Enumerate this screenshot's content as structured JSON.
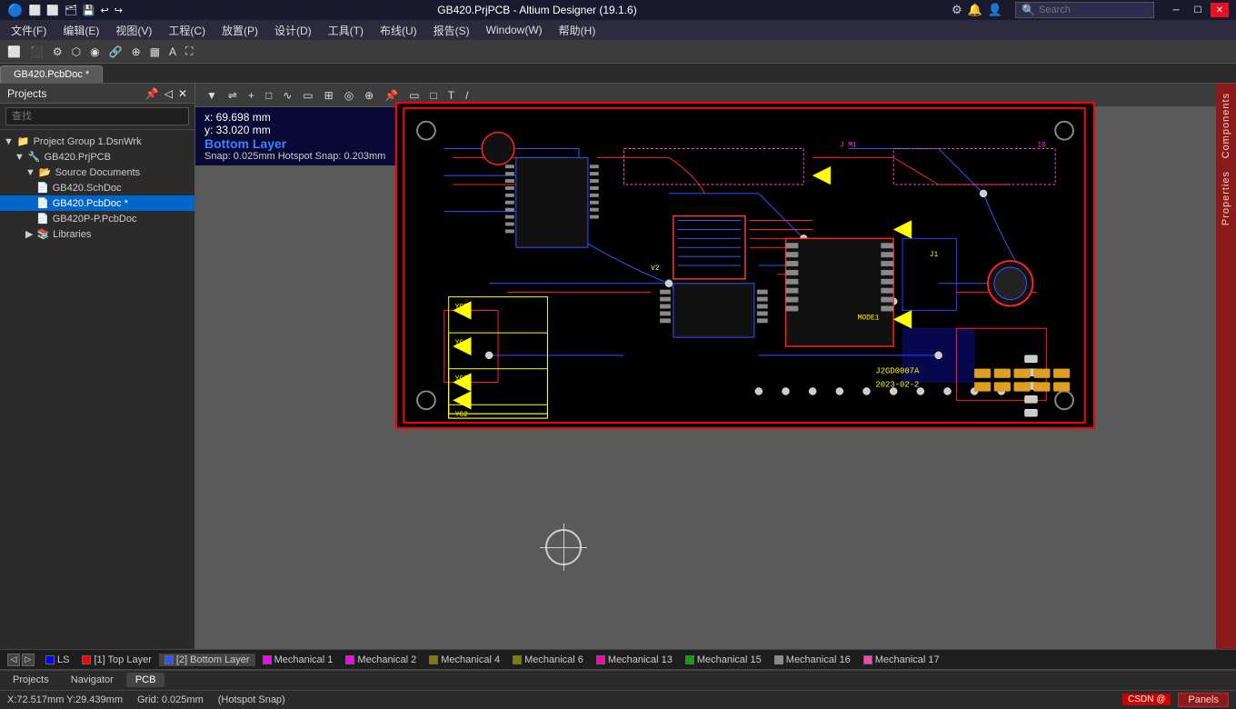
{
  "titleBar": {
    "title": "GB420.PrjPCB - Altium Designer (19.1.6)",
    "searchPlaceholder": "Search",
    "minBtn": "─",
    "maxBtn": "☐",
    "closeBtn": "✕"
  },
  "menuBar": {
    "items": [
      {
        "label": "文件(F)"
      },
      {
        "label": "编辑(E)"
      },
      {
        "label": "视图(V)"
      },
      {
        "label": "工程(C)"
      },
      {
        "label": "放置(P)"
      },
      {
        "label": "设计(D)"
      },
      {
        "label": "工具(T)"
      },
      {
        "label": "布线(U)"
      },
      {
        "label": "报告(S)"
      },
      {
        "label": "Window(W)"
      },
      {
        "label": "帮助(H)"
      }
    ]
  },
  "tabs": [
    {
      "label": "GB420.PcbDoc *",
      "active": true
    }
  ],
  "coordBar": {
    "x": "x: 69.698 mm",
    "y": "y: 33.020 mm",
    "layer": "Bottom Layer",
    "snap": "Snap: 0.025mm Hotspot Snap: 0.203mm"
  },
  "leftPanel": {
    "title": "Projects",
    "searchPlaceholder": "查找",
    "tree": [
      {
        "level": 0,
        "label": "Project Group 1.DsnWrk",
        "icon": "▼",
        "type": "group"
      },
      {
        "level": 1,
        "label": "GB420.PrjPCB",
        "icon": "▼",
        "type": "project"
      },
      {
        "level": 2,
        "label": "Source Documents",
        "icon": "▼",
        "type": "folder"
      },
      {
        "level": 3,
        "label": "GB420.SchDoc",
        "icon": "📄",
        "type": "file"
      },
      {
        "level": 3,
        "label": "GB420.PcbDoc *",
        "icon": "📄",
        "type": "file",
        "selected": true
      },
      {
        "level": 3,
        "label": "GB420P-P.PcbDoc",
        "icon": "📄",
        "type": "file"
      },
      {
        "level": 2,
        "label": "Libraries",
        "icon": "▶",
        "type": "folder"
      }
    ]
  },
  "rightSideTabs": [
    {
      "label": "Components"
    },
    {
      "label": "Properties"
    }
  ],
  "layerBar": {
    "layers": [
      {
        "label": "LS",
        "color": "#0000ff"
      },
      {
        "label": "[1] Top Layer",
        "color": "#ff0000",
        "active": false
      },
      {
        "label": "[2] Bottom Layer",
        "color": "#4444ff",
        "active": true
      },
      {
        "label": "Mechanical 1",
        "color": "#ff00ff"
      },
      {
        "label": "Mechanical 2",
        "color": "#ff00ff"
      },
      {
        "label": "Mechanical 4",
        "color": "#808000"
      },
      {
        "label": "Mechanical 6",
        "color": "#808000"
      },
      {
        "label": "Mechanical 13",
        "color": "#ff00aa"
      },
      {
        "label": "Mechanical 15",
        "color": "#00aa00"
      },
      {
        "label": "Mechanical 16",
        "color": "#888888"
      },
      {
        "label": "Mechanical 17",
        "color": "#ff44aa"
      }
    ]
  },
  "bottomTabs": [
    {
      "label": "Projects",
      "active": false
    },
    {
      "label": "Navigator",
      "active": false
    },
    {
      "label": "PCB",
      "active": true
    }
  ],
  "statusBar": {
    "coords": "X:72.517mm Y:29.439mm",
    "grid": "Grid: 0.025mm",
    "snap": "(Hotspot Snap)",
    "panels": "Panels",
    "csdn": "CSDN @"
  },
  "pcbToolbar": {
    "icons": [
      "▼",
      "⊕",
      "+",
      "□",
      "∿",
      "▭",
      "⊞",
      "◈",
      "⊕",
      "📌",
      "▭",
      "□",
      "T",
      "/"
    ]
  },
  "colors": {
    "titleBarBg": "#1a1a2e",
    "menuBarBg": "#2b2b3d",
    "toolbarBg": "#3c3c3c",
    "leftPanelBg": "#2b2b2b",
    "rightTabBg": "#8b1a1a",
    "canvasBg": "#5a5a5a",
    "pcbBg": "#000000",
    "topLayerColor": "#ff2222",
    "bottomLayerColor": "#3366ff",
    "mechColor": "#cc44cc",
    "accentBlue": "#0066cc"
  }
}
